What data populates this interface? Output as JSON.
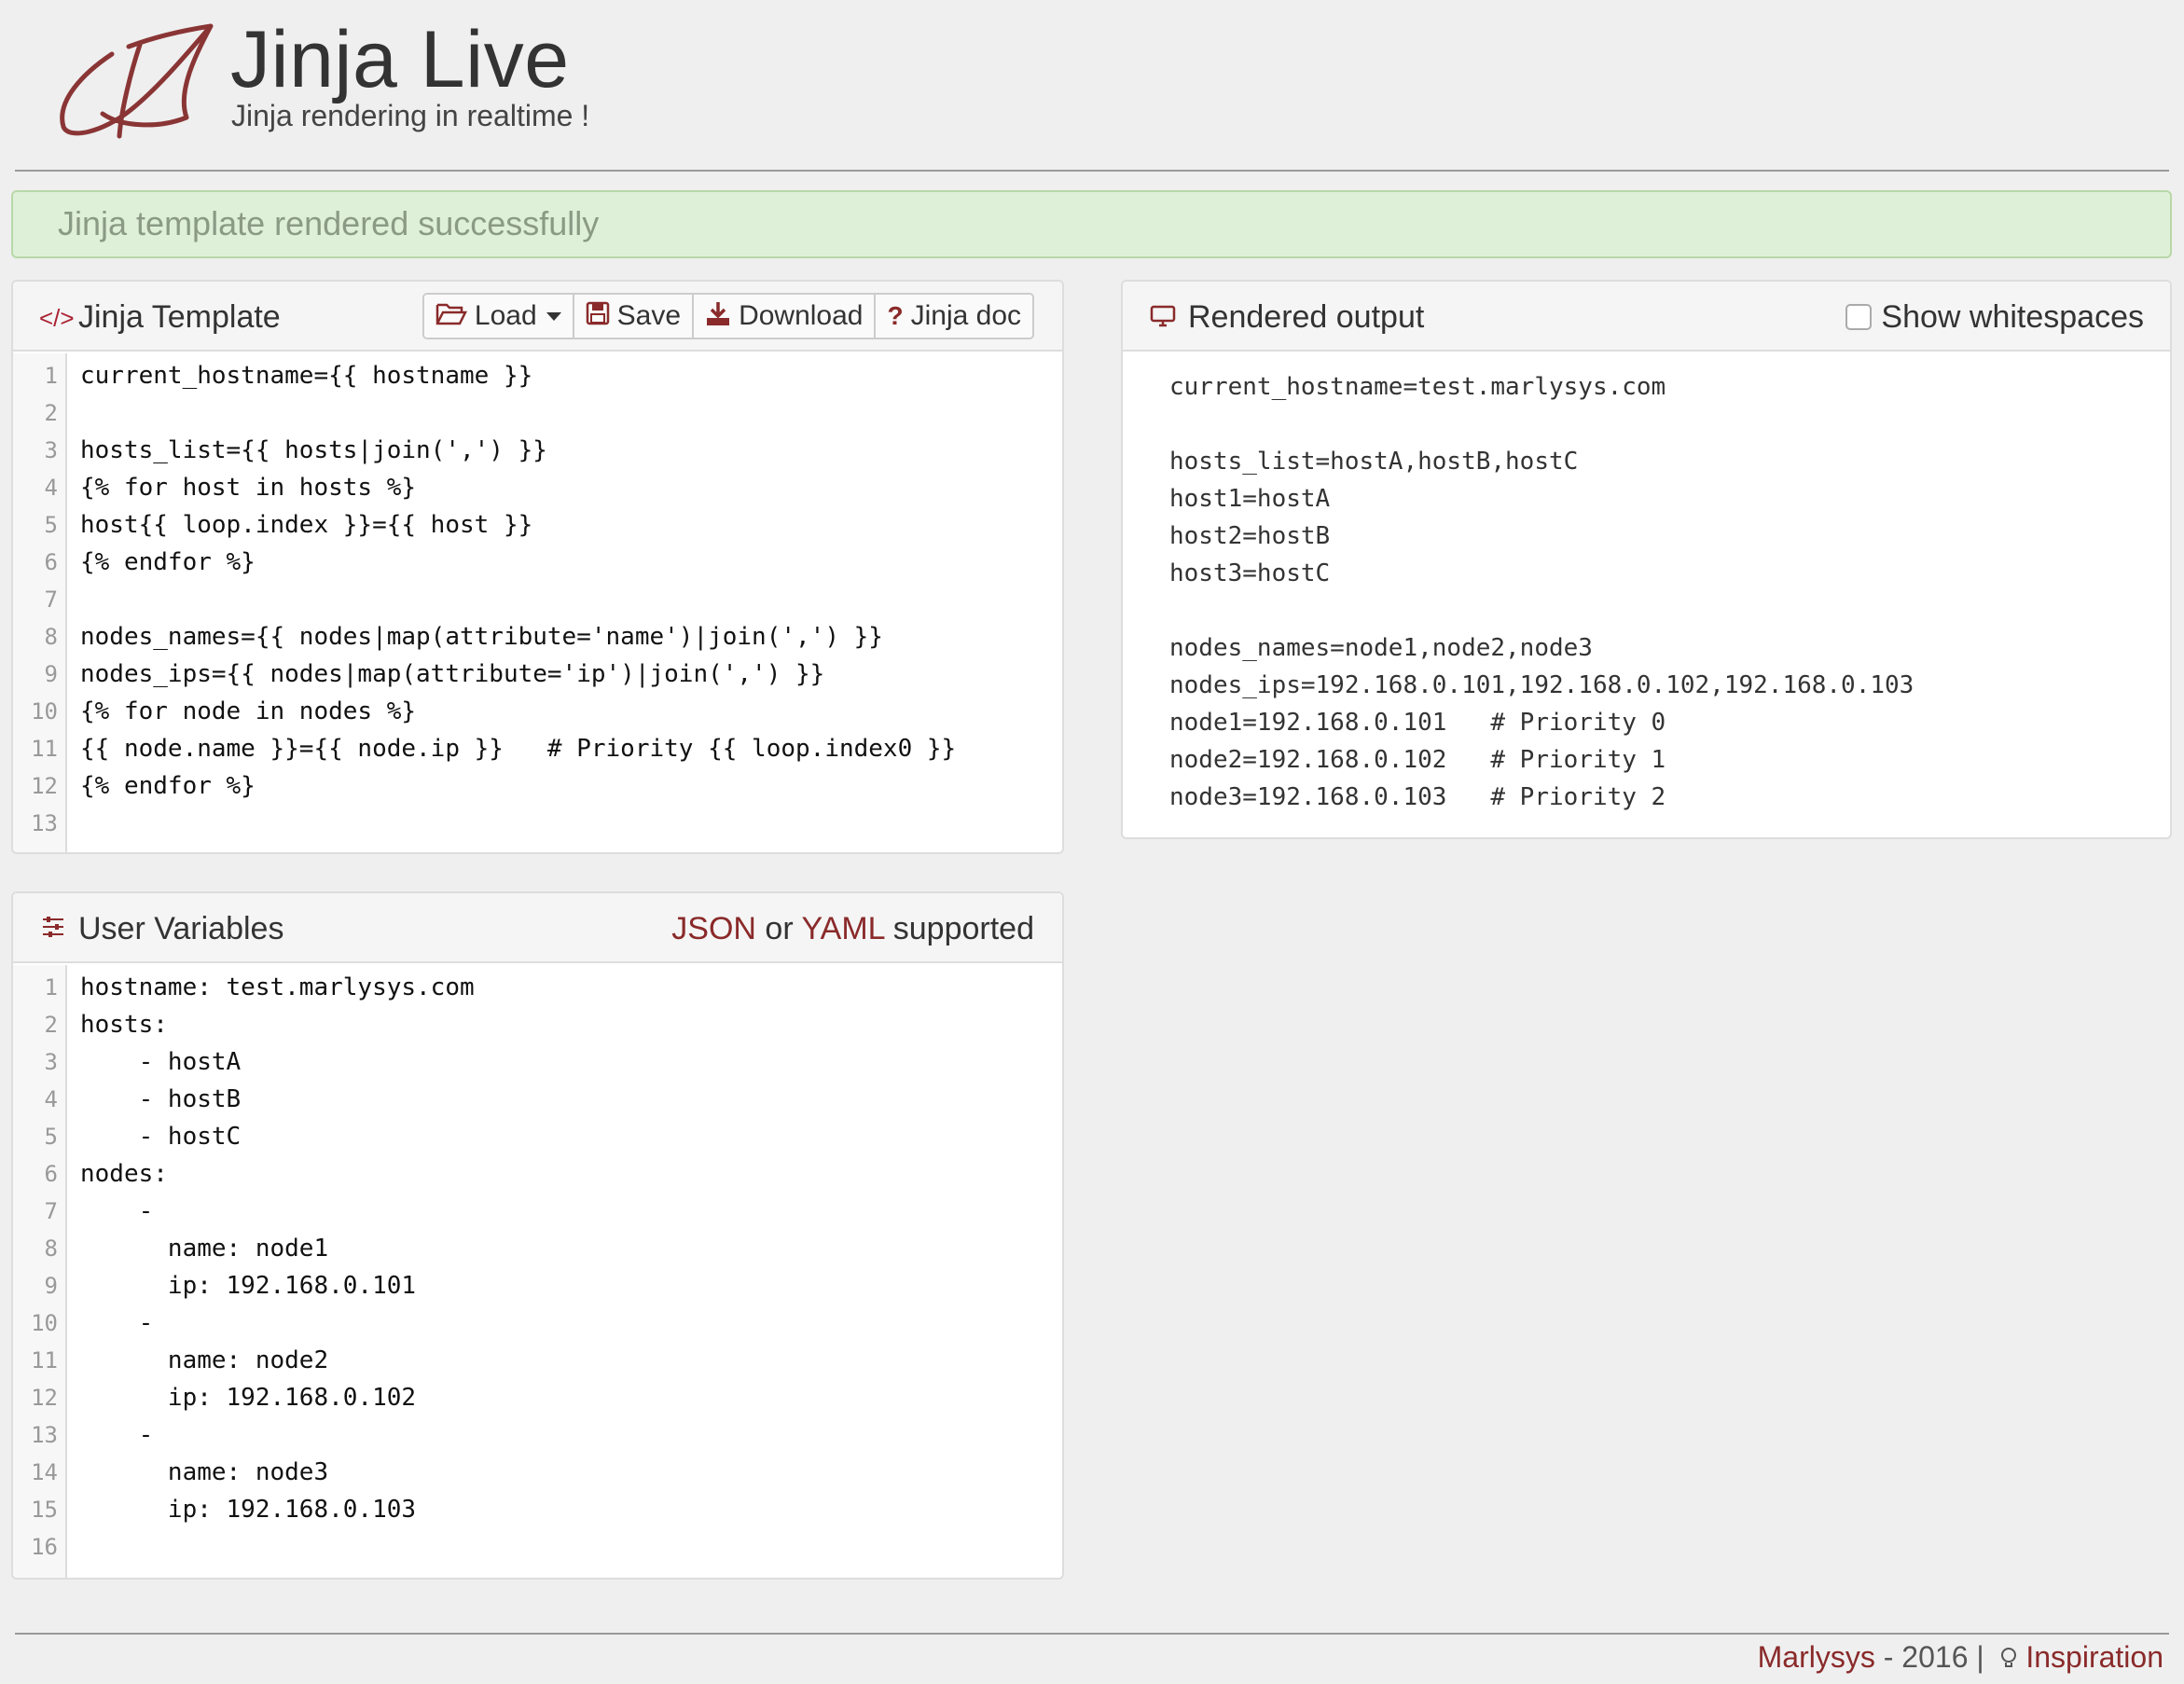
{
  "header": {
    "title": "Jinja Live",
    "subtitle": "Jinja rendering in realtime !"
  },
  "alert": {
    "message": "Jinja template rendered successfully",
    "color": "#dff0d8"
  },
  "template_panel": {
    "title": "Jinja Template",
    "icon": "code-icon",
    "buttons": {
      "load": "Load",
      "save": "Save",
      "download": "Download",
      "jinja_doc": "Jinja doc"
    },
    "lines": [
      {
        "n": "1",
        "text": "current_hostname={{ hostname }}"
      },
      {
        "n": "2",
        "text": ""
      },
      {
        "n": "3",
        "text": "hosts_list={{ hosts|join(',') }}"
      },
      {
        "n": "4",
        "text": "{% for host in hosts %}"
      },
      {
        "n": "5",
        "text": "host{{ loop.index }}={{ host }}"
      },
      {
        "n": "6",
        "text": "{% endfor %}"
      },
      {
        "n": "7",
        "text": ""
      },
      {
        "n": "8",
        "text": "nodes_names={{ nodes|map(attribute='name')|join(',') }}"
      },
      {
        "n": "9",
        "text": "nodes_ips={{ nodes|map(attribute='ip')|join(',') }}"
      },
      {
        "n": "10",
        "text": "{% for node in nodes %}"
      },
      {
        "n": "11",
        "text": "{{ node.name }}={{ node.ip }}   # Priority {{ loop.index0 }}"
      },
      {
        "n": "12",
        "text": "{% endfor %}"
      },
      {
        "n": "13",
        "text": ""
      }
    ]
  },
  "output_panel": {
    "title": "Rendered output",
    "icon": "monitor-icon",
    "show_whitespaces_label": "Show whitespaces",
    "show_whitespaces_checked": false,
    "lines": [
      "current_hostname=test.marlysys.com",
      "",
      "hosts_list=hostA,hostB,hostC",
      "host1=hostA",
      "host2=hostB",
      "host3=hostC",
      "",
      "nodes_names=node1,node2,node3",
      "nodes_ips=192.168.0.101,192.168.0.102,192.168.0.103",
      "node1=192.168.0.101   # Priority 0",
      "node2=192.168.0.102   # Priority 1",
      "node3=192.168.0.103   # Priority 2"
    ]
  },
  "vars_panel": {
    "title": "User Variables",
    "icon": "sliders-icon",
    "note_json": "JSON",
    "note_or": "or",
    "note_yaml": "YAML",
    "note_supported": "supported",
    "lines": [
      {
        "n": "1",
        "text": "hostname: test.marlysys.com"
      },
      {
        "n": "2",
        "text": "hosts:"
      },
      {
        "n": "3",
        "text": "    - hostA"
      },
      {
        "n": "4",
        "text": "    - hostB"
      },
      {
        "n": "5",
        "text": "    - hostC"
      },
      {
        "n": "6",
        "text": "nodes:"
      },
      {
        "n": "7",
        "text": "    -"
      },
      {
        "n": "8",
        "text": "      name: node1"
      },
      {
        "n": "9",
        "text": "      ip: 192.168.0.101"
      },
      {
        "n": "10",
        "text": "    -"
      },
      {
        "n": "11",
        "text": "      name: node2"
      },
      {
        "n": "12",
        "text": "      ip: 192.168.0.102"
      },
      {
        "n": "13",
        "text": "    -"
      },
      {
        "n": "14",
        "text": "      name: node3"
      },
      {
        "n": "15",
        "text": "      ip: 192.168.0.103"
      },
      {
        "n": "16",
        "text": ""
      }
    ]
  },
  "footer": {
    "brand": "Marlysys",
    "year_sep": " - 2016 | ",
    "inspiration": "Inspiration",
    "accent": "#8a2a2a"
  }
}
